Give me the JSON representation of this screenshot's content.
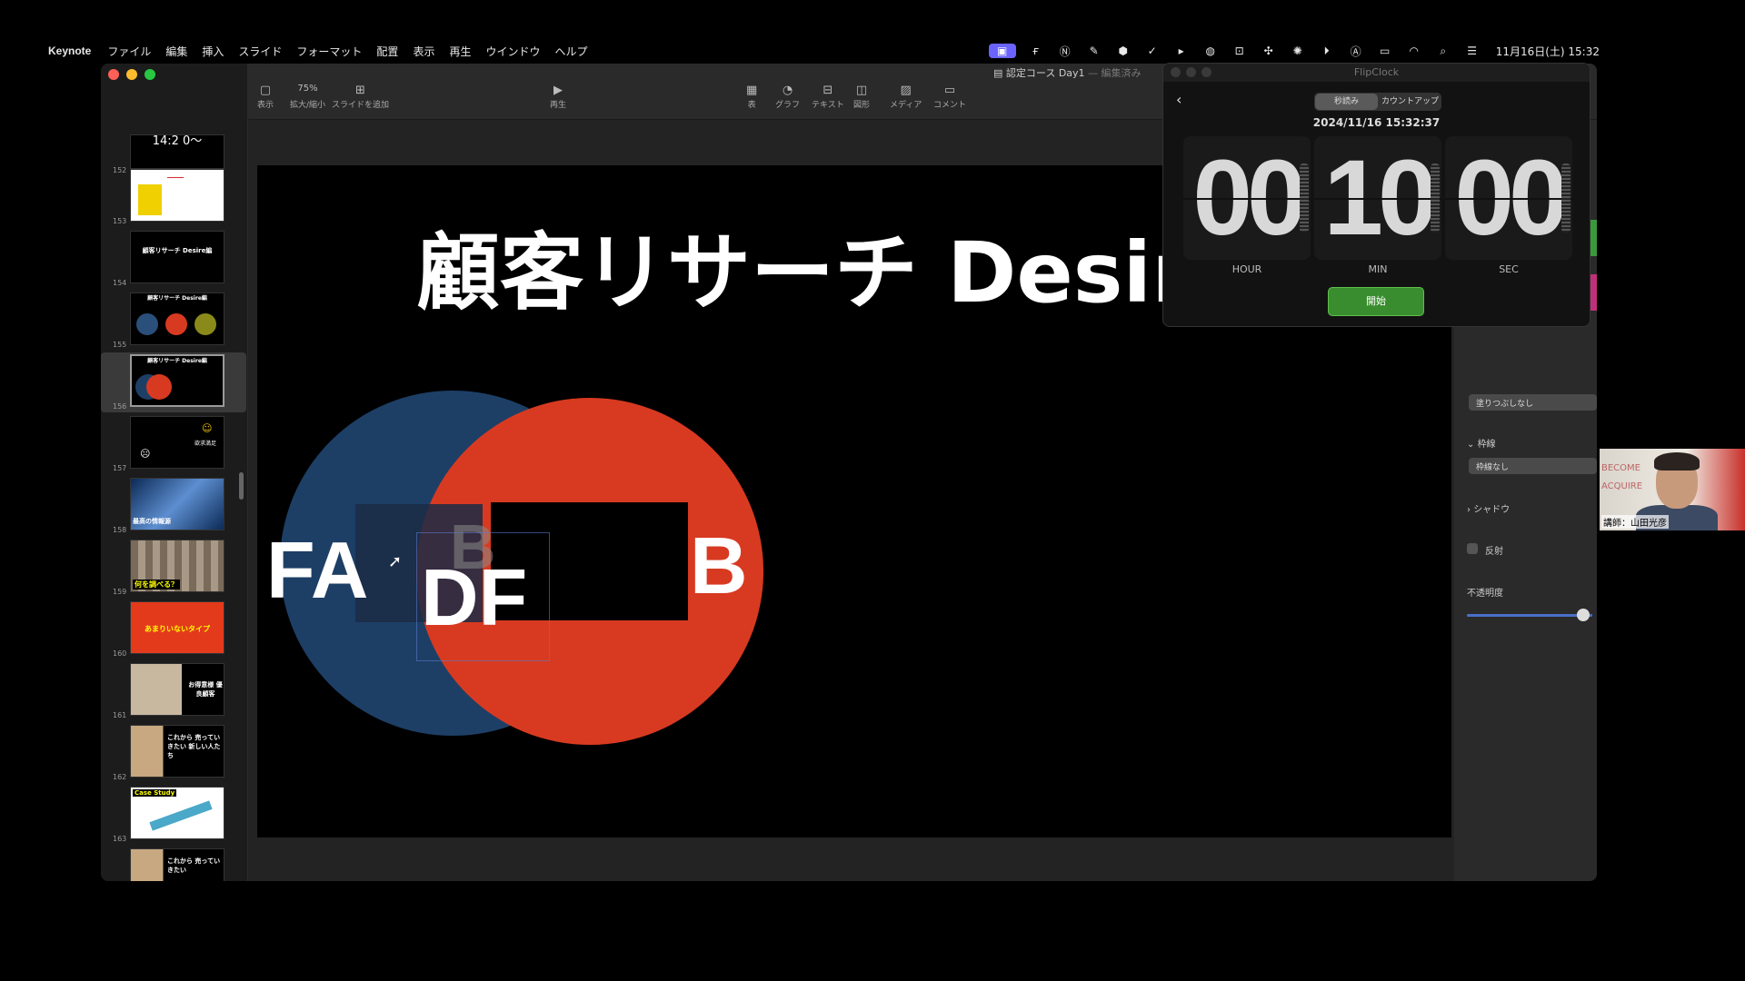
{
  "menubar": {
    "app": "Keynote",
    "items": [
      "ファイル",
      "編集",
      "挿入",
      "スライド",
      "フォーマット",
      "配置",
      "表示",
      "再生",
      "ウインドウ",
      "ヘルプ"
    ],
    "clock": "11月16日(土) 15:32"
  },
  "document": {
    "title": "認定コース Day1",
    "status": "— 編集済み"
  },
  "toolbar": {
    "view": "表示",
    "zoom_value": "75%",
    "zoom": "拡大/縮小",
    "add_slide": "スライドを追加",
    "play": "再生",
    "table": "表",
    "chart": "グラフ",
    "text": "テキスト",
    "shape": "図形",
    "media": "メディア",
    "comment": "コメント"
  },
  "slides": [
    {
      "num": "152",
      "label": "14:2 0～"
    },
    {
      "num": "153",
      "label": ""
    },
    {
      "num": "154",
      "label": "顧客リサーチ Desire編"
    },
    {
      "num": "155",
      "label": "顧客リサーチ Desire編"
    },
    {
      "num": "156",
      "label": "顧客リサーチ Desire編"
    },
    {
      "num": "157",
      "label": "欲求満足"
    },
    {
      "num": "158",
      "label": "最高の情報源"
    },
    {
      "num": "159",
      "label": "何を調べる？"
    },
    {
      "num": "160",
      "label": "あまりいないタイプ"
    },
    {
      "num": "161",
      "label": "お得意様 優良顧客"
    },
    {
      "num": "162",
      "label": "これから 売っていきたい 新しい人たち"
    },
    {
      "num": "163",
      "label": "Case Study"
    },
    {
      "num": "164",
      "label": "これから 売っていきたい"
    }
  ],
  "slide": {
    "title": "顧客リサーチ Desire",
    "label_fa": "FA",
    "label_b_ghost": "B",
    "label_df": "DF",
    "label_b": "B",
    "colors": {
      "blue": "#1d3f66",
      "red": "#d83a21"
    }
  },
  "inspector": {
    "fill": "塗りつぶしなし",
    "border_head": "枠線",
    "border": "枠線なし",
    "shadow": "シャドウ",
    "reflection": "反射",
    "opacity": "不透明度"
  },
  "flipclock": {
    "title": "FlipClock",
    "seg_countdown": "秒読み",
    "seg_countup": "カウントアップ",
    "date": "2024/11/16 15:32:37",
    "hour": "00",
    "min": "10",
    "sec": "00",
    "hour_label": "HOUR",
    "min_label": "MIN",
    "sec_label": "SEC",
    "start": "開始"
  },
  "webcam": {
    "caption": "講師：山田光彦",
    "bg_text_1": "BECOME",
    "bg_text_2": "ACQUIRE"
  }
}
